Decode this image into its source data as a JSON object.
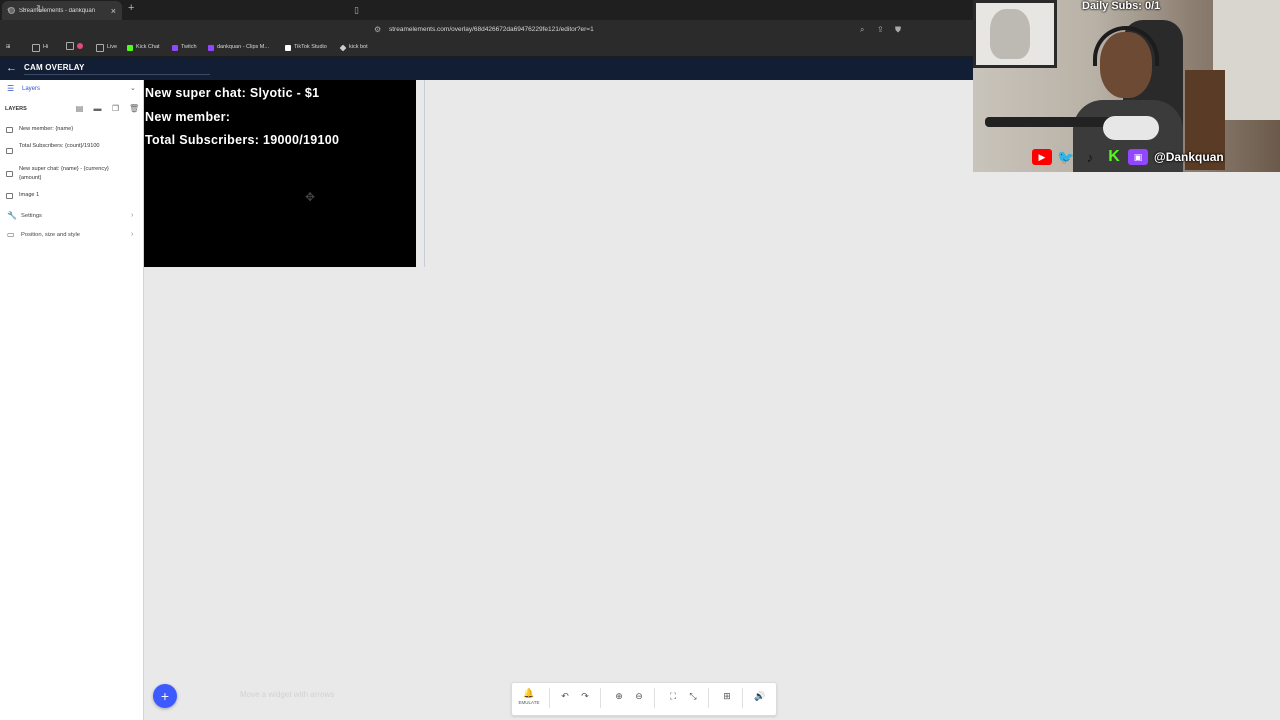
{
  "browser": {
    "tab_title": "StreamElements - dankquan",
    "url": "streamelements.com/overlay/68d426672da69476229fe121/editor?er=1",
    "bookmarks": [
      {
        "label": "Hi",
        "color": "#888888"
      },
      {
        "label": "",
        "color": "#e04b7a"
      },
      {
        "label": "Live",
        "color": "#cccccc"
      },
      {
        "label": "Kick Chat",
        "color": "#53fc18"
      },
      {
        "label": "Twitch",
        "color": "#9146ff"
      },
      {
        "label": "dankquan - Clips M...",
        "color": "#9146ff"
      },
      {
        "label": "TikTok Studio",
        "color": "#ffffff"
      },
      {
        "label": "kick bot",
        "color": "#cccccc"
      }
    ]
  },
  "app": {
    "title": "CAM OVERLAY"
  },
  "sidebar": {
    "header_label": "Layers",
    "layers_label": "LAYERS",
    "items": [
      {
        "label": "New member: {name}"
      },
      {
        "label": "Total Subscribers: {count}/19100"
      },
      {
        "label": "New super chat: {name} - {currency}{amount}"
      },
      {
        "label": "Image 1"
      }
    ],
    "sections": [
      {
        "label": "Settings",
        "icon": "wrench-icon"
      },
      {
        "label": "Position, size and style",
        "icon": "layout-icon"
      }
    ]
  },
  "overlay": {
    "line1": "New super chat: Slyotic - $1",
    "line2": "New member:",
    "line3": "Total Subscribers: 19000/19100"
  },
  "bottom": {
    "add_label": "+",
    "hint": "Move a widget with arrows",
    "emulate_label": "EMULATE"
  },
  "webcam": {
    "daily_subs": "Daily Subs: 0/1",
    "handle": "@Dankquan",
    "social_colors": {
      "youtube": "#ff0000",
      "twitter": "#1da1f2",
      "tiktok": "#111111",
      "kick": "#53fc18",
      "twitch": "#9146ff"
    }
  },
  "colors": {
    "appbar": "#121e33",
    "accent": "#3d5afe"
  }
}
